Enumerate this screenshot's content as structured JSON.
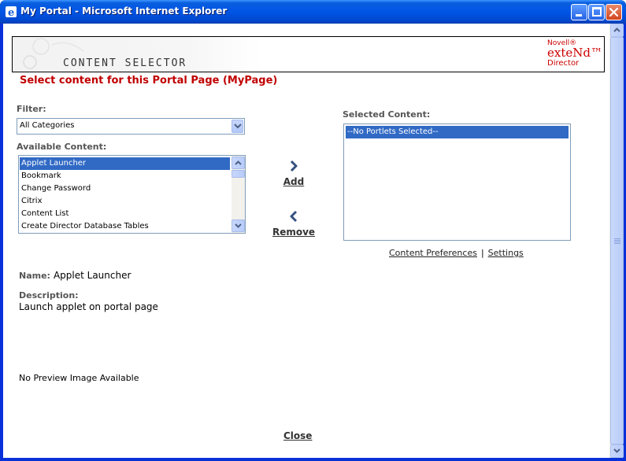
{
  "window": {
    "title": "My Portal - Microsoft Internet Explorer",
    "colors": {
      "title_bar": "#0055e5",
      "close_button": "#d2451f"
    }
  },
  "banner": {
    "title": "CONTENT SELECTOR",
    "brand_top": "Novell®",
    "brand_main": "exteNd™",
    "brand_bottom": "Director",
    "brand_color": "#cc0000"
  },
  "page": {
    "heading": "Select content for this Portal Page (MyPage)",
    "heading_color": "#c00000"
  },
  "filter": {
    "label": "Filter:",
    "selected": "All Categories"
  },
  "available": {
    "label": "Available Content:",
    "items": [
      "Applet Launcher",
      "Bookmark",
      "Change Password",
      "Citrix",
      "Content List",
      "Create Director Database Tables"
    ],
    "selected_index": 0
  },
  "selected": {
    "label": "Selected Content:",
    "items": [
      "--No Portlets Selected--"
    ]
  },
  "actions": {
    "add": "Add",
    "remove": "Remove"
  },
  "links": {
    "content_preferences": "Content Preferences",
    "separator": "|",
    "settings": "Settings"
  },
  "details": {
    "name_label": "Name:",
    "name_value": "Applet Launcher",
    "description_label": "Description:",
    "description_value": "Launch applet on portal page",
    "preview_text": "No Preview Image Available"
  },
  "footer": {
    "close": "Close"
  },
  "icons": {
    "title_icon": "ie-icon",
    "add": "chevron-right-icon",
    "remove": "chevron-left-icon"
  }
}
